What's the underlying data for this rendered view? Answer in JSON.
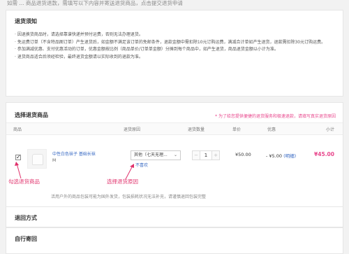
{
  "top_text": "如需 ... 商品退货退款，需填写以下内容并寄送退货商品，点击提交退货申请",
  "notice": {
    "title": "退货须知",
    "items": [
      "· 因退换货商品时，请选择靠谱快递并预付运费，否则无法办理退货。",
      "· 免运费订单（不含特品图订单）产生退货后，如金额不满足该订单的免邮条件，退款金额中需扣除10元订购运费，满减合计单如产生退货，退款需扣除30元订购运费。",
      "· 参加满减优惠、支付优惠活动的订单，优惠金额按比例（商品单价/订单单金额）分摊到每个商品中，如产生退货，商品退货金额以小计为准。",
      "· 退货商品适合后须经检验，最终退货金额请以实际收到的退款为准。"
    ]
  },
  "select": {
    "title": "选择退货商品",
    "tip": "* 为了给您提供便捷的退货服务和极速退款，请填写真实退货原因",
    "columns": [
      "商品",
      "退货原因",
      "退货数量",
      "单价",
      "优惠",
      "小计"
    ],
    "item": {
      "checked": "✓",
      "name": "中性白色袜子 基础长袜",
      "size": "M",
      "reason": "其他（七天无理...",
      "reason_link": "不喜欢",
      "qty": "1",
      "qty_minus": "−",
      "qty_plus": "+",
      "price": "¥50.00",
      "discount": "- ¥5.00",
      "discount_link": "(明细)",
      "subtotal": "¥45.00"
    },
    "foot_note": "活用户外的商品包装可能为国外发货，包装损耗状况无法补充，请谨慎退回包装完整"
  },
  "annotations": {
    "left": "勾选退货商品",
    "middle": "选择退货原因"
  },
  "return_method": {
    "title": "退回方式"
  },
  "self_send": {
    "title": "自行寄回"
  }
}
